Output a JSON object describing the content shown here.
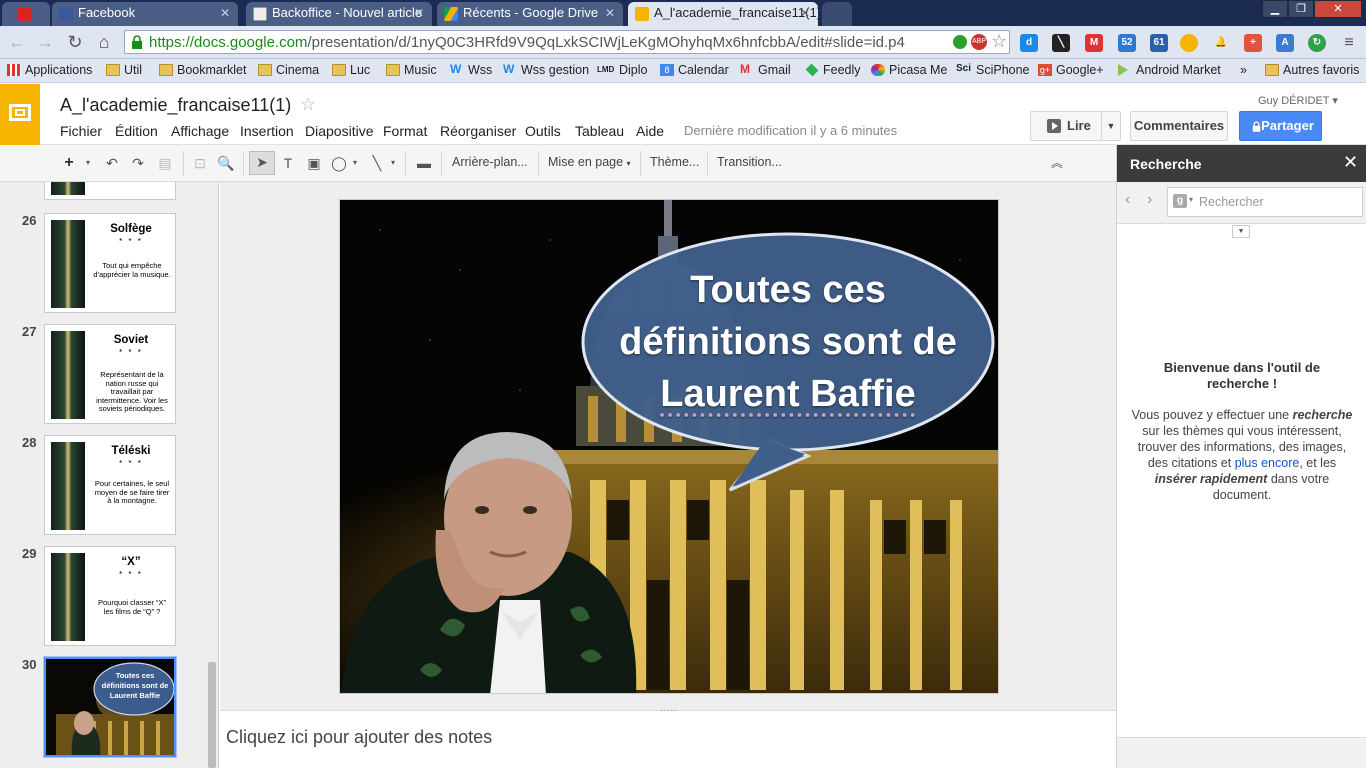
{
  "browser": {
    "tabs": [
      {
        "label": "",
        "icon": "youtube-icon"
      },
      {
        "label": "Facebook",
        "icon": "facebook-icon"
      },
      {
        "label": "Backoffice - Nouvel article",
        "icon": "document-icon"
      },
      {
        "label": "Récents - Google Drive",
        "icon": "drive-icon"
      },
      {
        "label": "A_l'academie_francaise11(1)",
        "icon": "slides-icon"
      }
    ],
    "url_host": "https://docs.google.com",
    "url_path": "/presentation/d/1nyQ0C3HRfd9V9QqLxkSCIWjLeKgMOhyhqMx6hnfcbbA/edit#slide=id.p4",
    "bookmarks": [
      "Applications",
      "Util",
      "Bookmarklet",
      "Cinema",
      "Luc",
      "Music",
      "Wss",
      "Wss gestion",
      "Diplo",
      "Calendar",
      "Gmail",
      "Feedly",
      "Picasa Me",
      "SciPhone",
      "Google+",
      "Android Market"
    ],
    "more_bookmarks": "»",
    "other_bookmarks": "Autres favoris"
  },
  "docs": {
    "title": "A_l'academie_francaise11(1)",
    "menus": [
      "Fichier",
      "Édition",
      "Affichage",
      "Insertion",
      "Diapositive",
      "Format",
      "Réorganiser",
      "Outils",
      "Tableau",
      "Aide"
    ],
    "last_modified": "Dernière modification il y a 6 minutes",
    "user": "Guy DÉRIDET",
    "present_label": "Lire",
    "comments_label": "Commentaires",
    "share_label": "Partager"
  },
  "toolbar": {
    "background_label": "Arrière-plan...",
    "layout_label": "Mise en page",
    "theme_label": "Thème...",
    "transition_label": "Transition..."
  },
  "filmstrip": {
    "slides": [
      {
        "number": "26",
        "title": "Solfège",
        "stars": "* * *",
        "definition": "Tout qui empêche d'apprécier la musique."
      },
      {
        "number": "27",
        "title": "Soviet",
        "stars": "* * *",
        "definition": "Représentant de la nation russe qui travaillait par intermittence. Voir les soviets périodiques."
      },
      {
        "number": "28",
        "title": "Téléski",
        "stars": "* * *",
        "definition": "Pour certaines, le seul moyen de se faire tirer à la montagne."
      },
      {
        "number": "29",
        "title": "“X”",
        "stars": "* * *",
        "definition": "Pourquoi classer “X” les films de “Q” ?"
      },
      {
        "number": "30",
        "title": "Toutes ces définitions sont de Laurent Baffie"
      }
    ]
  },
  "slide": {
    "bubble_line1": "Toutes ces",
    "bubble_line2": "définitions sont de",
    "bubble_line3": "Laurent Baffie"
  },
  "notes_placeholder": "Cliquez ici pour ajouter des notes",
  "research": {
    "title": "Recherche",
    "close": "✕",
    "search_placeholder": "Rechercher",
    "welcome_title": "Bienvenue dans l'outil de recherche !",
    "body_1": "Vous pouvez y effectuer une ",
    "body_em1": "recherche",
    "body_2": " sur les thèmes qui vous intéressent, trouver des informations, des images, des citations et ",
    "body_link": "plus encore",
    "body_3": ", et les ",
    "body_em2": "insérer rapidement",
    "body_4": " dans votre document."
  },
  "colors": {
    "accent": "#4a8af4",
    "slides_brand": "#f4b400",
    "tab_strip": "#1c2b52"
  }
}
